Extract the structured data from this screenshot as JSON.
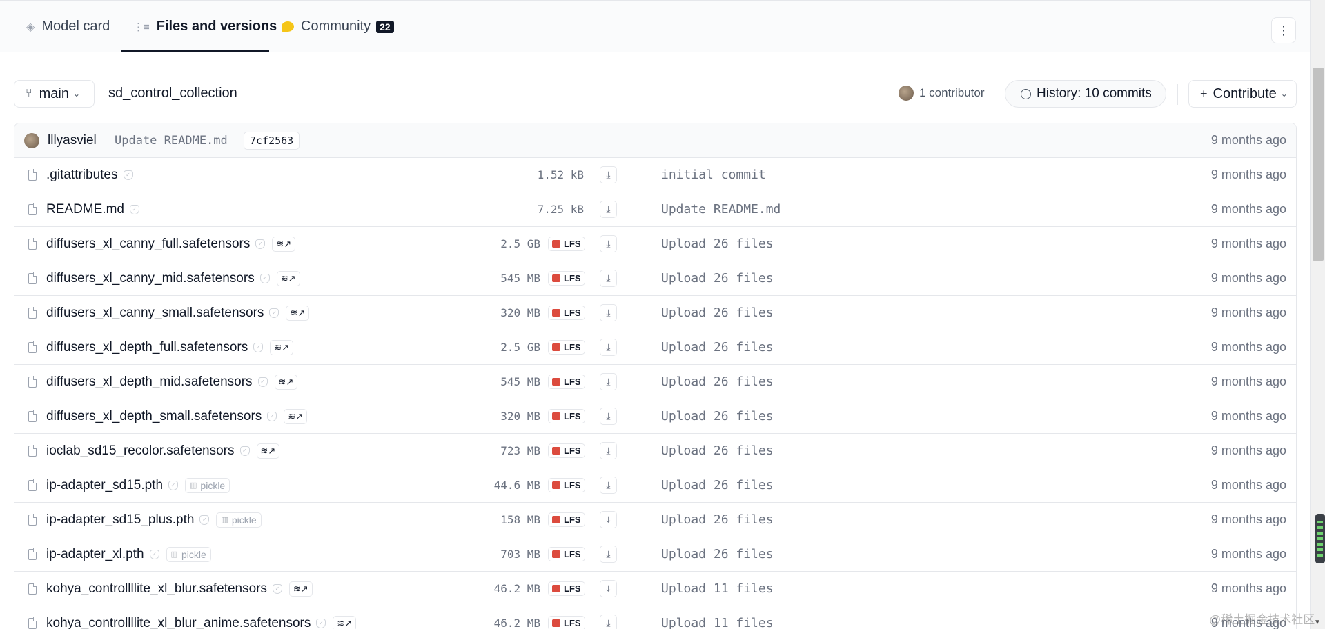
{
  "tabs": [
    {
      "label": "Model card",
      "icon": "model-card-icon"
    },
    {
      "label": "Files and versions",
      "icon": "files-icon",
      "active": true
    },
    {
      "label": "Community",
      "icon": "community-icon",
      "count": "22"
    }
  ],
  "toolbar": {
    "branch": "main",
    "path": "sd_control_collection",
    "contributors": "1 contributor",
    "history": "History: 10 commits",
    "contribute": "Contribute"
  },
  "last_commit": {
    "author": "lllyasviel",
    "message": "Update README.md",
    "sha": "7cf2563",
    "date": "9 months ago"
  },
  "files": [
    {
      "name": ".gitattributes",
      "size": "1.52 kB",
      "lfs": false,
      "badge": "",
      "message": "initial commit",
      "date": "9 months ago"
    },
    {
      "name": "README.md",
      "size": "7.25 kB",
      "lfs": false,
      "badge": "",
      "message": "Update README.md",
      "date": "9 months ago"
    },
    {
      "name": "diffusers_xl_canny_full.safetensors",
      "size": "2.5 GB",
      "lfs": true,
      "badge": "safetensors",
      "message": "Upload 26 files",
      "date": "9 months ago"
    },
    {
      "name": "diffusers_xl_canny_mid.safetensors",
      "size": "545 MB",
      "lfs": true,
      "badge": "safetensors",
      "message": "Upload 26 files",
      "date": "9 months ago"
    },
    {
      "name": "diffusers_xl_canny_small.safetensors",
      "size": "320 MB",
      "lfs": true,
      "badge": "safetensors",
      "message": "Upload 26 files",
      "date": "9 months ago"
    },
    {
      "name": "diffusers_xl_depth_full.safetensors",
      "size": "2.5 GB",
      "lfs": true,
      "badge": "safetensors",
      "message": "Upload 26 files",
      "date": "9 months ago"
    },
    {
      "name": "diffusers_xl_depth_mid.safetensors",
      "size": "545 MB",
      "lfs": true,
      "badge": "safetensors",
      "message": "Upload 26 files",
      "date": "9 months ago"
    },
    {
      "name": "diffusers_xl_depth_small.safetensors",
      "size": "320 MB",
      "lfs": true,
      "badge": "safetensors",
      "message": "Upload 26 files",
      "date": "9 months ago"
    },
    {
      "name": "ioclab_sd15_recolor.safetensors",
      "size": "723 MB",
      "lfs": true,
      "badge": "safetensors",
      "message": "Upload 26 files",
      "date": "9 months ago"
    },
    {
      "name": "ip-adapter_sd15.pth",
      "size": "44.6 MB",
      "lfs": true,
      "badge": "pickle",
      "message": "Upload 26 files",
      "date": "9 months ago"
    },
    {
      "name": "ip-adapter_sd15_plus.pth",
      "size": "158 MB",
      "lfs": true,
      "badge": "pickle",
      "message": "Upload 26 files",
      "date": "9 months ago"
    },
    {
      "name": "ip-adapter_xl.pth",
      "size": "703 MB",
      "lfs": true,
      "badge": "pickle",
      "message": "Upload 26 files",
      "date": "9 months ago"
    },
    {
      "name": "kohya_controllllite_xl_blur.safetensors",
      "size": "46.2 MB",
      "lfs": true,
      "badge": "safetensors",
      "message": "Upload 11 files",
      "date": "9 months ago"
    },
    {
      "name": "kohya_controllllite_xl_blur_anime.safetensors",
      "size": "46.2 MB",
      "lfs": true,
      "badge": "safetensors",
      "message": "Upload 11 files",
      "date": "9 months ago"
    }
  ],
  "labels": {
    "lfs": "LFS",
    "pickle": "pickle",
    "safetensors_glyph": "≋↗"
  },
  "watermark": "@稀土掘金技术社区",
  "colors": {
    "lfs_cube": "#dc4b3e",
    "active_tab_underline": "#111827",
    "count_badge": "#111827"
  }
}
